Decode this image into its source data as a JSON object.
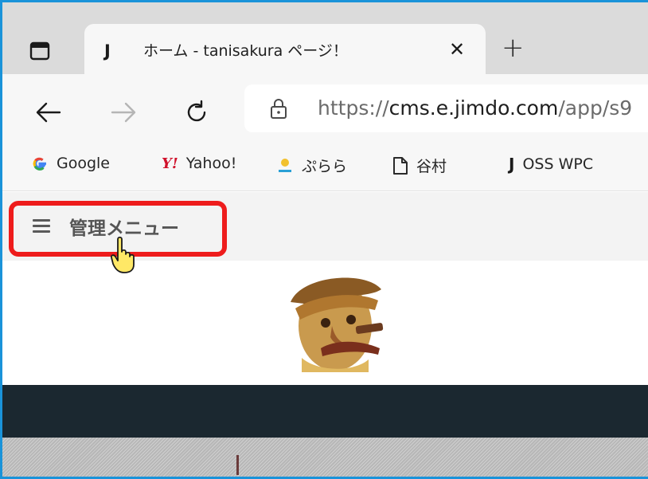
{
  "browser": {
    "tab": {
      "favicon_letter": "J",
      "title": "ホーム - tanisakura ページ！",
      "close_glyph": "✕"
    },
    "new_tab_glyph": "+",
    "url": {
      "scheme": "https://",
      "host": "cms.e.jimdo.com",
      "path": "/app/s9"
    }
  },
  "bookmarks": [
    {
      "icon": "google-icon",
      "label": "Google"
    },
    {
      "icon": "yahoo-icon",
      "label": "Yahoo!"
    },
    {
      "icon": "purara-icon",
      "label": "ぷらら"
    },
    {
      "icon": "page-icon",
      "label": "谷村"
    },
    {
      "icon": "jimdo-icon",
      "label": "OSS WPC"
    }
  ],
  "admin": {
    "menu_label": "管理メニュー"
  },
  "colors": {
    "highlight": "#ee1c1c",
    "frame": "#1a93d9",
    "dark_band": "#1b2830"
  }
}
